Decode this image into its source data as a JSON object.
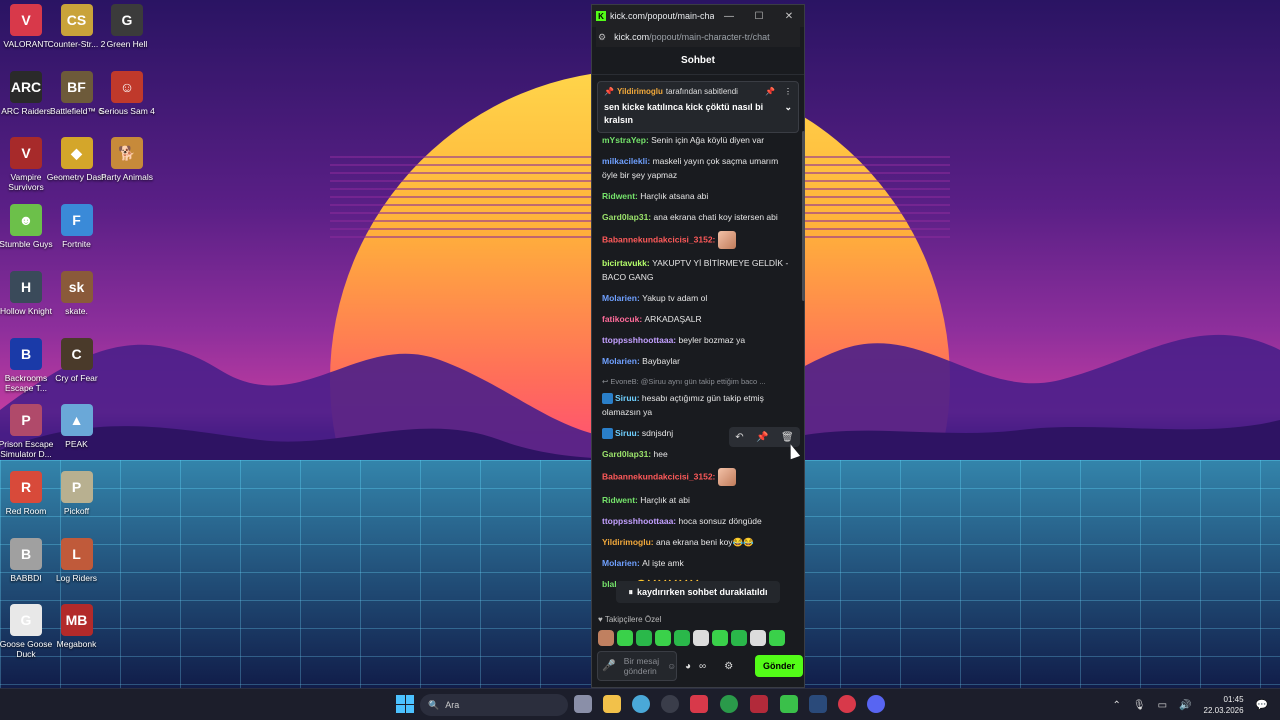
{
  "desktop": {
    "icons": [
      {
        "label": "VALORANT",
        "color": "#d8394a",
        "glyph": "V"
      },
      {
        "label": "Counter-Str... 2",
        "color": "#c9a33a",
        "glyph": "CS"
      },
      {
        "label": "Green Hell",
        "color": "#3b3b3b",
        "glyph": "G"
      },
      {
        "label": "ARC Raiders",
        "color": "#2a2a2a",
        "glyph": "ARC"
      },
      {
        "label": "Battlefield™ 6",
        "color": "#6d5a3a",
        "glyph": "BF"
      },
      {
        "label": "Serious Sam 4",
        "color": "#c0392b",
        "glyph": "☺"
      },
      {
        "label": "Vampire Survivors",
        "color": "#a72a2a",
        "glyph": "V"
      },
      {
        "label": "Geometry Dash",
        "color": "#d4a62a",
        "glyph": "◆"
      },
      {
        "label": "Party Animals",
        "color": "#c78a3a",
        "glyph": "🐕"
      },
      {
        "label": "Stumble Guys",
        "color": "#6cc04a",
        "glyph": "☻"
      },
      {
        "label": "Fortnite",
        "color": "#3a8ad8",
        "glyph": "F"
      },
      {
        "label": "Hollow Knight",
        "color": "#3a4a5a",
        "glyph": "H"
      },
      {
        "label": "skate.",
        "color": "#8a5a3a",
        "glyph": "sk"
      },
      {
        "label": "Backrooms Escape T...",
        "color": "#1a3aa8",
        "glyph": "B"
      },
      {
        "label": "Cry of Fear",
        "color": "#4a3a2a",
        "glyph": "C"
      },
      {
        "label": "Prison Escape Simulator D...",
        "color": "#b04a6a",
        "glyph": "P"
      },
      {
        "label": "PEAK",
        "color": "#6aa8d8",
        "glyph": "▲"
      },
      {
        "label": "Red Room",
        "color": "#d84a3a",
        "glyph": "R"
      },
      {
        "label": "Pickoff",
        "color": "#b8b090",
        "glyph": "P"
      },
      {
        "label": "BABBDI",
        "color": "#a0a0a0",
        "glyph": "B"
      },
      {
        "label": "Log Riders",
        "color": "#c05a3a",
        "glyph": "L"
      },
      {
        "label": "Goose Goose Duck",
        "color": "#e8e8e8",
        "glyph": "G"
      },
      {
        "label": "Megabonk",
        "color": "#b22a2a",
        "glyph": "MB"
      }
    ]
  },
  "window": {
    "title": "kick.com/popout/main-char...",
    "url_host": "kick.com",
    "url_path": "/popout/main-character-tr/chat",
    "minimize": "—",
    "maximize": "☐",
    "close": "✕"
  },
  "chat": {
    "header": "Sohbet",
    "pinned": {
      "user": "Yildirimoglu",
      "suffix": "tarafından sabitlendi",
      "message": "sen kicke katılınca kick çöktü nasıl bi kralsın"
    },
    "messages": [
      {
        "user": "mYstraYep",
        "color": "#75e36b",
        "text": "Senin için Ağa köylü diyen var"
      },
      {
        "user": "milkacilekli",
        "color": "#6fa0ff",
        "text": "maskeli yayın çok saçma umarım öyle bir şey yapmaz"
      },
      {
        "user": "Ridwent",
        "color": "#75e36b",
        "text": "Harçlık atsana abi"
      },
      {
        "user": "Gard0lap31",
        "color": "#9be36b",
        "text": "ana ekrana chati koy istersen abi"
      },
      {
        "user": "Babannekundakcicisi_3152",
        "color": "#ff5a5a",
        "text": "",
        "emote": true
      },
      {
        "user": "bicirtavukk",
        "color": "#b5ff6b",
        "text": "YAKUPTV Yİ BİTİRMEYE GELDİK - BACO GANG"
      },
      {
        "user": "Molarien",
        "color": "#6fa0ff",
        "text": "Yakup tv adam ol"
      },
      {
        "user": "fatikocuk",
        "color": "#ff6b9a",
        "text": "ARKADAŞALR"
      },
      {
        "user": "ttoppsshhoottaaa",
        "color": "#c3a0ff",
        "text": "beyler bozmaz ya"
      },
      {
        "user": "Molarien",
        "color": "#6fa0ff",
        "text": "Baybaylar"
      },
      {
        "user": "Siruu",
        "color": "#6fd0ff",
        "text": "hesabı açtığımız gün takip etmiş olamazsın ya",
        "reply": "EvoneB: @Siruu aynı gün takip ettiğim baco ...",
        "badge": true
      },
      {
        "user": "Siruu",
        "color": "#6fd0ff",
        "text": "sdnjsdnj",
        "badge": true
      },
      {
        "user": "Gard0lap31",
        "color": "#9be36b",
        "text": "hee"
      },
      {
        "user": "Babannekundakcicisi_3152",
        "color": "#ff5a5a",
        "text": "",
        "emote": true
      },
      {
        "user": "Ridwent",
        "color": "#75e36b",
        "text": "Harçlık at abi"
      },
      {
        "user": "ttoppsshhoottaaa",
        "color": "#c3a0ff",
        "text": "hoca sonsuz döngüde"
      },
      {
        "user": "Yildirimoglu",
        "color": "#f2a93b",
        "text": "ana ekrana beni koy😂😂"
      },
      {
        "user": "Molarien",
        "color": "#6fa0ff",
        "text": "Al işte amk"
      },
      {
        "user": "blalaex",
        "color": "#75e36b",
        "text": "😂😹😹😹😹😹"
      }
    ],
    "paused_text": "kaydırırken sohbet duraklatıldı",
    "subs_label": "Takipçilere Özel",
    "input_placeholder": "Bir mesaj gönderin",
    "send_label": "Gönder"
  },
  "taskbar": {
    "search_placeholder": "Ara",
    "time": "01:45",
    "date": "22.03.2026"
  }
}
